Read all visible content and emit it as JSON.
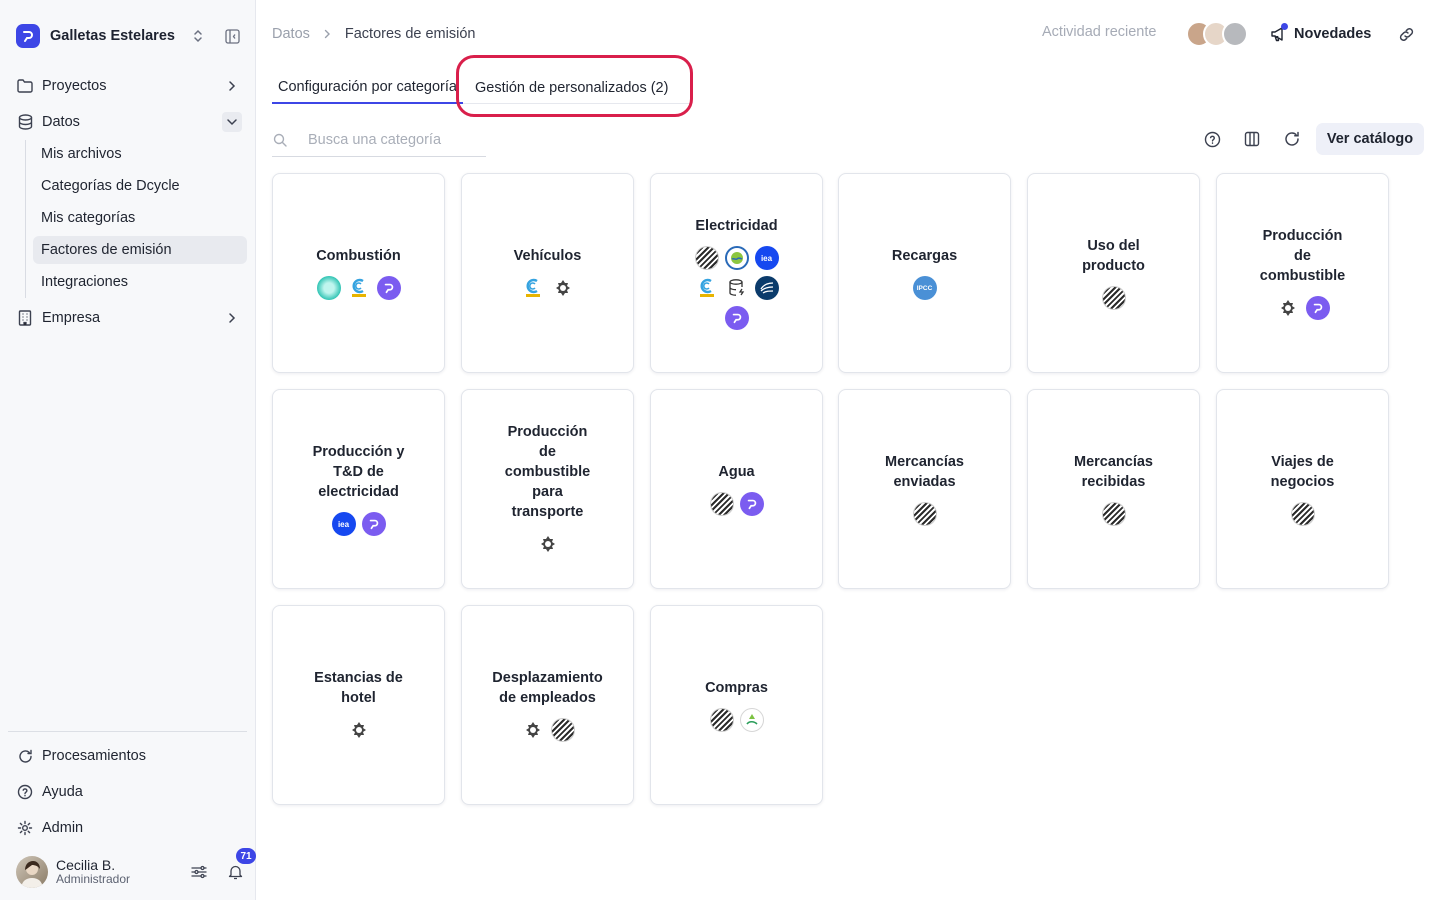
{
  "workspace": {
    "name": "Galletas Estelares"
  },
  "sidebar": {
    "items": [
      {
        "label": "Proyectos"
      },
      {
        "label": "Datos"
      },
      {
        "label": "Empresa"
      }
    ],
    "data_subitems": [
      {
        "label": "Mis archivos"
      },
      {
        "label": "Categorías de Dcycle"
      },
      {
        "label": "Mis categorías"
      },
      {
        "label": "Factores de emisión"
      },
      {
        "label": "Integraciones"
      }
    ],
    "bottom_items": [
      {
        "label": "Procesamientos"
      },
      {
        "label": "Ayuda"
      },
      {
        "label": "Admin"
      }
    ],
    "user": {
      "name": "Cecilia B.",
      "role": "Administrador",
      "notifications": "71"
    }
  },
  "header": {
    "breadcrumb": {
      "parent": "Datos",
      "current": "Factores de emisión"
    },
    "activity_label": "Actividad reciente",
    "news_label": "Novedades"
  },
  "tabs": [
    {
      "label": "Configuración por categoría"
    },
    {
      "label": "Gestión de personalizados (2)"
    }
  ],
  "search": {
    "placeholder": "Busca una categoría",
    "value": ""
  },
  "catalog_button": "Ver catálogo",
  "cards": [
    {
      "title": "Combustión",
      "sources": [
        "teal-circle-icon",
        "mitma-logo-icon",
        "dcycle-logo-icon"
      ]
    },
    {
      "title": "Vehículos",
      "sources": [
        "mitma-logo-icon",
        "crest-logo-icon"
      ]
    },
    {
      "title": "Electricidad",
      "sources": [
        "striped-logo-icon",
        "epa-logo-icon",
        "iea-logo-icon",
        "mitma-logo-icon",
        "energy-db-icon",
        "ree-logo-icon",
        "dcycle-logo-icon"
      ]
    },
    {
      "title": "Recargas",
      "sources": [
        "ipcc-logo-icon"
      ]
    },
    {
      "title": "Uso del producto",
      "sources": [
        "striped-logo-icon"
      ]
    },
    {
      "title": "Producción de combustible",
      "sources": [
        "crest-logo-icon",
        "dcycle-logo-icon"
      ]
    },
    {
      "title": "Producción y T&D de electricidad",
      "sources": [
        "iea-logo-icon",
        "dcycle-logo-icon"
      ]
    },
    {
      "title": "Producción de combustible para transporte",
      "sources": [
        "crest-logo-icon"
      ]
    },
    {
      "title": "Agua",
      "sources": [
        "striped-logo-icon",
        "dcycle-logo-icon"
      ]
    },
    {
      "title": "Mercancías enviadas",
      "sources": [
        "striped-logo-icon"
      ]
    },
    {
      "title": "Mercancías recibidas",
      "sources": [
        "striped-logo-icon"
      ]
    },
    {
      "title": "Viajes de negocios",
      "sources": [
        "striped-logo-icon"
      ]
    },
    {
      "title": "Estancias de hotel",
      "sources": [
        "crest-logo-icon"
      ]
    },
    {
      "title": "Desplazamiento de empleados",
      "sources": [
        "crest-logo-icon",
        "striped-logo-icon"
      ]
    },
    {
      "title": "Compras",
      "sources": [
        "striped-logo-icon",
        "recycle-logo-icon"
      ]
    }
  ],
  "logo_text": {
    "iea": "iea",
    "ipcc": "IPCC"
  },
  "colors": {
    "accent": "#3d46e6",
    "highlight": "#d91f4b",
    "dcycle": "#7b5cf0"
  }
}
